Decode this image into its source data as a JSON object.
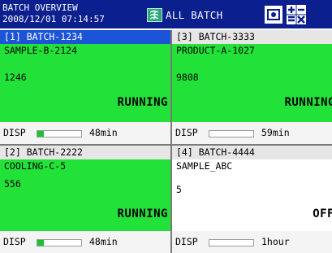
{
  "header": {
    "title_line1": "BATCH OVERVIEW",
    "title_line2": "2008/12/01 07:14:57",
    "mode_label": "ALL BATCH",
    "icons": [
      "status-icon",
      "display-icon",
      "calculator-icon"
    ]
  },
  "panels": [
    {
      "header": "[1] BATCH-1234",
      "name": "SAMPLE-B-2124",
      "value": "1246",
      "status": "RUNNING",
      "disp_label": "DISP",
      "disp_time": "48min",
      "progress": 0.15,
      "selected": true
    },
    {
      "header": "[3] BATCH-3333",
      "name": "PRODUCT-A-1027",
      "value": "9808",
      "status": "RUNNING",
      "disp_label": "DISP",
      "disp_time": "59min",
      "progress": 0,
      "selected": false
    },
    {
      "header": "[2] BATCH-2222",
      "name": "COOLING-C-5",
      "value": "556",
      "status": "RUNNING",
      "disp_label": "DISP",
      "disp_time": "48min",
      "progress": 0.15,
      "selected": false
    },
    {
      "header": "[4] BATCH-4444",
      "name": "SAMPLE_ABC",
      "value": "5",
      "status": "OFF",
      "disp_label": "DISP",
      "disp_time": "1hour",
      "progress": 0,
      "selected": false
    }
  ],
  "colors": {
    "header_bg": "#0b1f8f",
    "selected_header": "#1c54d8",
    "running_green": "#22e23a",
    "off_white": "#ffffff",
    "bar_fill": "#1fc134"
  }
}
